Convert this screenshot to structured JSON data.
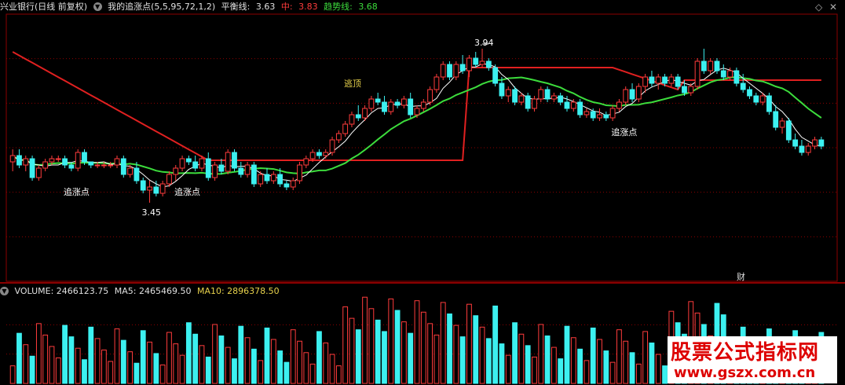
{
  "header": {
    "stock": "兴业银行(日线 前复权)",
    "indicator": "我的追涨点(5,5,95,72,1,2)",
    "balance_label": "平衡线:",
    "balance_value": "3.63",
    "mid_label": "中:",
    "mid_value": "3.83",
    "trend_label": "趋势线:",
    "trend_value": "3.68"
  },
  "volume_header": {
    "volume": "VOLUME: 2466123.75",
    "ma5": "MA5: 2465469.50",
    "ma10": "MA10: 2896378.50"
  },
  "watermark": {
    "text": "股票公式指标网",
    "url": "www.gszx.com.cn"
  },
  "finance_marker": "财",
  "colors": {
    "up": "#ff3c3c",
    "down": "#3cf0f0",
    "trend_line": "#3cdc3c",
    "mid_line": "#e02020",
    "balance_line": "#ffffff",
    "grid": "#8b0000"
  },
  "chart_data": {
    "type": "candlestick",
    "annotations": [
      {
        "text": "追涨点",
        "bar": 9
      },
      {
        "text": "追涨点",
        "bar": 26
      },
      {
        "text": "追涨点",
        "bar": 93
      },
      {
        "text": "逃顶",
        "bar": 52
      },
      {
        "text": "3.94",
        "bar": 72
      },
      {
        "text": "3.45",
        "bar": 21
      }
    ],
    "candles": [
      [
        3.58,
        3.62,
        3.55,
        3.6
      ],
      [
        3.6,
        3.62,
        3.56,
        3.57
      ],
      [
        3.57,
        3.6,
        3.55,
        3.59
      ],
      [
        3.59,
        3.6,
        3.52,
        3.53
      ],
      [
        3.53,
        3.57,
        3.52,
        3.56
      ],
      [
        3.56,
        3.59,
        3.55,
        3.58
      ],
      [
        3.58,
        3.6,
        3.57,
        3.59
      ],
      [
        3.59,
        3.6,
        3.58,
        3.59
      ],
      [
        3.59,
        3.6,
        3.56,
        3.57
      ],
      [
        3.57,
        3.58,
        3.55,
        3.56
      ],
      [
        3.56,
        3.62,
        3.55,
        3.61
      ],
      [
        3.61,
        3.62,
        3.57,
        3.58
      ],
      [
        3.58,
        3.58,
        3.56,
        3.57
      ],
      [
        3.57,
        3.58,
        3.56,
        3.57
      ],
      [
        3.57,
        3.58,
        3.56,
        3.57
      ],
      [
        3.57,
        3.58,
        3.56,
        3.57
      ],
      [
        3.57,
        3.6,
        3.56,
        3.59
      ],
      [
        3.59,
        3.6,
        3.53,
        3.54
      ],
      [
        3.54,
        3.57,
        3.53,
        3.56
      ],
      [
        3.56,
        3.58,
        3.51,
        3.52
      ],
      [
        3.52,
        3.53,
        3.48,
        3.49
      ],
      [
        3.49,
        3.52,
        3.45,
        3.5
      ],
      [
        3.5,
        3.52,
        3.47,
        3.48
      ],
      [
        3.48,
        3.52,
        3.47,
        3.51
      ],
      [
        3.51,
        3.55,
        3.5,
        3.54
      ],
      [
        3.54,
        3.57,
        3.52,
        3.56
      ],
      [
        3.56,
        3.6,
        3.55,
        3.59
      ],
      [
        3.59,
        3.6,
        3.57,
        3.58
      ],
      [
        3.58,
        3.6,
        3.55,
        3.56
      ],
      [
        3.56,
        3.6,
        3.55,
        3.59
      ],
      [
        3.59,
        3.61,
        3.52,
        3.53
      ],
      [
        3.53,
        3.58,
        3.52,
        3.57
      ],
      [
        3.57,
        3.59,
        3.54,
        3.55
      ],
      [
        3.55,
        3.62,
        3.54,
        3.61
      ],
      [
        3.61,
        3.62,
        3.55,
        3.56
      ],
      [
        3.56,
        3.58,
        3.53,
        3.54
      ],
      [
        3.54,
        3.58,
        3.53,
        3.57
      ],
      [
        3.57,
        3.58,
        3.5,
        3.51
      ],
      [
        3.51,
        3.55,
        3.5,
        3.54
      ],
      [
        3.54,
        3.56,
        3.51,
        3.52
      ],
      [
        3.52,
        3.55,
        3.51,
        3.54
      ],
      [
        3.54,
        3.56,
        3.5,
        3.51
      ],
      [
        3.51,
        3.52,
        3.49,
        3.5
      ],
      [
        3.5,
        3.53,
        3.49,
        3.52
      ],
      [
        3.52,
        3.58,
        3.51,
        3.57
      ],
      [
        3.57,
        3.6,
        3.56,
        3.59
      ],
      [
        3.59,
        3.62,
        3.58,
        3.61
      ],
      [
        3.61,
        3.62,
        3.59,
        3.6
      ],
      [
        3.6,
        3.62,
        3.59,
        3.61
      ],
      [
        3.61,
        3.66,
        3.6,
        3.65
      ],
      [
        3.65,
        3.68,
        3.64,
        3.67
      ],
      [
        3.67,
        3.71,
        3.66,
        3.7
      ],
      [
        3.7,
        3.74,
        3.69,
        3.73
      ],
      [
        3.73,
        3.76,
        3.71,
        3.72
      ],
      [
        3.72,
        3.76,
        3.71,
        3.75
      ],
      [
        3.75,
        3.79,
        3.74,
        3.78
      ],
      [
        3.78,
        3.8,
        3.76,
        3.77
      ],
      [
        3.77,
        3.79,
        3.73,
        3.74
      ],
      [
        3.74,
        3.78,
        3.73,
        3.77
      ],
      [
        3.77,
        3.78,
        3.75,
        3.76
      ],
      [
        3.76,
        3.79,
        3.75,
        3.78
      ],
      [
        3.78,
        3.8,
        3.72,
        3.73
      ],
      [
        3.73,
        3.76,
        3.72,
        3.75
      ],
      [
        3.75,
        3.78,
        3.74,
        3.77
      ],
      [
        3.77,
        3.82,
        3.76,
        3.81
      ],
      [
        3.81,
        3.86,
        3.8,
        3.85
      ],
      [
        3.85,
        3.9,
        3.84,
        3.89
      ],
      [
        3.89,
        3.9,
        3.84,
        3.85
      ],
      [
        3.85,
        3.9,
        3.84,
        3.89
      ],
      [
        3.89,
        3.92,
        3.86,
        3.87
      ],
      [
        3.87,
        3.92,
        3.85,
        3.91
      ],
      [
        3.91,
        3.93,
        3.88,
        3.89
      ],
      [
        3.89,
        3.94,
        3.88,
        3.9
      ],
      [
        3.9,
        3.91,
        3.87,
        3.88
      ],
      [
        3.88,
        3.89,
        3.82,
        3.83
      ],
      [
        3.83,
        3.85,
        3.78,
        3.79
      ],
      [
        3.79,
        3.82,
        3.77,
        3.81
      ],
      [
        3.81,
        3.82,
        3.76,
        3.77
      ],
      [
        3.77,
        3.8,
        3.76,
        3.79
      ],
      [
        3.79,
        3.8,
        3.74,
        3.75
      ],
      [
        3.75,
        3.79,
        3.74,
        3.78
      ],
      [
        3.78,
        3.82,
        3.77,
        3.81
      ],
      [
        3.81,
        3.82,
        3.77,
        3.78
      ],
      [
        3.78,
        3.8,
        3.77,
        3.79
      ],
      [
        3.79,
        3.8,
        3.76,
        3.77
      ],
      [
        3.77,
        3.79,
        3.74,
        3.75
      ],
      [
        3.75,
        3.78,
        3.74,
        3.77
      ],
      [
        3.77,
        3.78,
        3.72,
        3.73
      ],
      [
        3.73,
        3.75,
        3.72,
        3.74
      ],
      [
        3.74,
        3.75,
        3.71,
        3.72
      ],
      [
        3.72,
        3.75,
        3.71,
        3.73
      ],
      [
        3.73,
        3.74,
        3.71,
        3.72
      ],
      [
        3.72,
        3.76,
        3.71,
        3.75
      ],
      [
        3.75,
        3.78,
        3.74,
        3.77
      ],
      [
        3.77,
        3.82,
        3.76,
        3.81
      ],
      [
        3.81,
        3.83,
        3.77,
        3.78
      ],
      [
        3.78,
        3.83,
        3.77,
        3.82
      ],
      [
        3.82,
        3.86,
        3.8,
        3.85
      ],
      [
        3.85,
        3.87,
        3.82,
        3.83
      ],
      [
        3.83,
        3.86,
        3.81,
        3.85
      ],
      [
        3.85,
        3.86,
        3.82,
        3.83
      ],
      [
        3.83,
        3.86,
        3.82,
        3.85
      ],
      [
        3.85,
        3.86,
        3.81,
        3.82
      ],
      [
        3.82,
        3.84,
        3.79,
        3.8
      ],
      [
        3.8,
        3.83,
        3.79,
        3.82
      ],
      [
        3.82,
        3.91,
        3.81,
        3.9
      ],
      [
        3.9,
        3.94,
        3.86,
        3.87
      ],
      [
        3.87,
        3.91,
        3.86,
        3.9
      ],
      [
        3.9,
        3.91,
        3.86,
        3.87
      ],
      [
        3.87,
        3.89,
        3.84,
        3.85
      ],
      [
        3.85,
        3.88,
        3.84,
        3.87
      ],
      [
        3.87,
        3.88,
        3.82,
        3.83
      ],
      [
        3.83,
        3.86,
        3.8,
        3.81
      ],
      [
        3.81,
        3.82,
        3.78,
        3.79
      ],
      [
        3.79,
        3.8,
        3.76,
        3.77
      ],
      [
        3.77,
        3.8,
        3.76,
        3.79
      ],
      [
        3.79,
        3.8,
        3.73,
        3.74
      ],
      [
        3.74,
        3.76,
        3.68,
        3.69
      ],
      [
        3.69,
        3.72,
        3.67,
        3.71
      ],
      [
        3.71,
        3.72,
        3.64,
        3.65
      ],
      [
        3.65,
        3.67,
        3.62,
        3.63
      ],
      [
        3.63,
        3.65,
        3.6,
        3.61
      ],
      [
        3.61,
        3.64,
        3.6,
        3.63
      ],
      [
        3.63,
        3.66,
        3.62,
        3.65
      ],
      [
        3.65,
        3.66,
        3.62,
        3.63
      ]
    ],
    "volume_index_max": 100
  }
}
